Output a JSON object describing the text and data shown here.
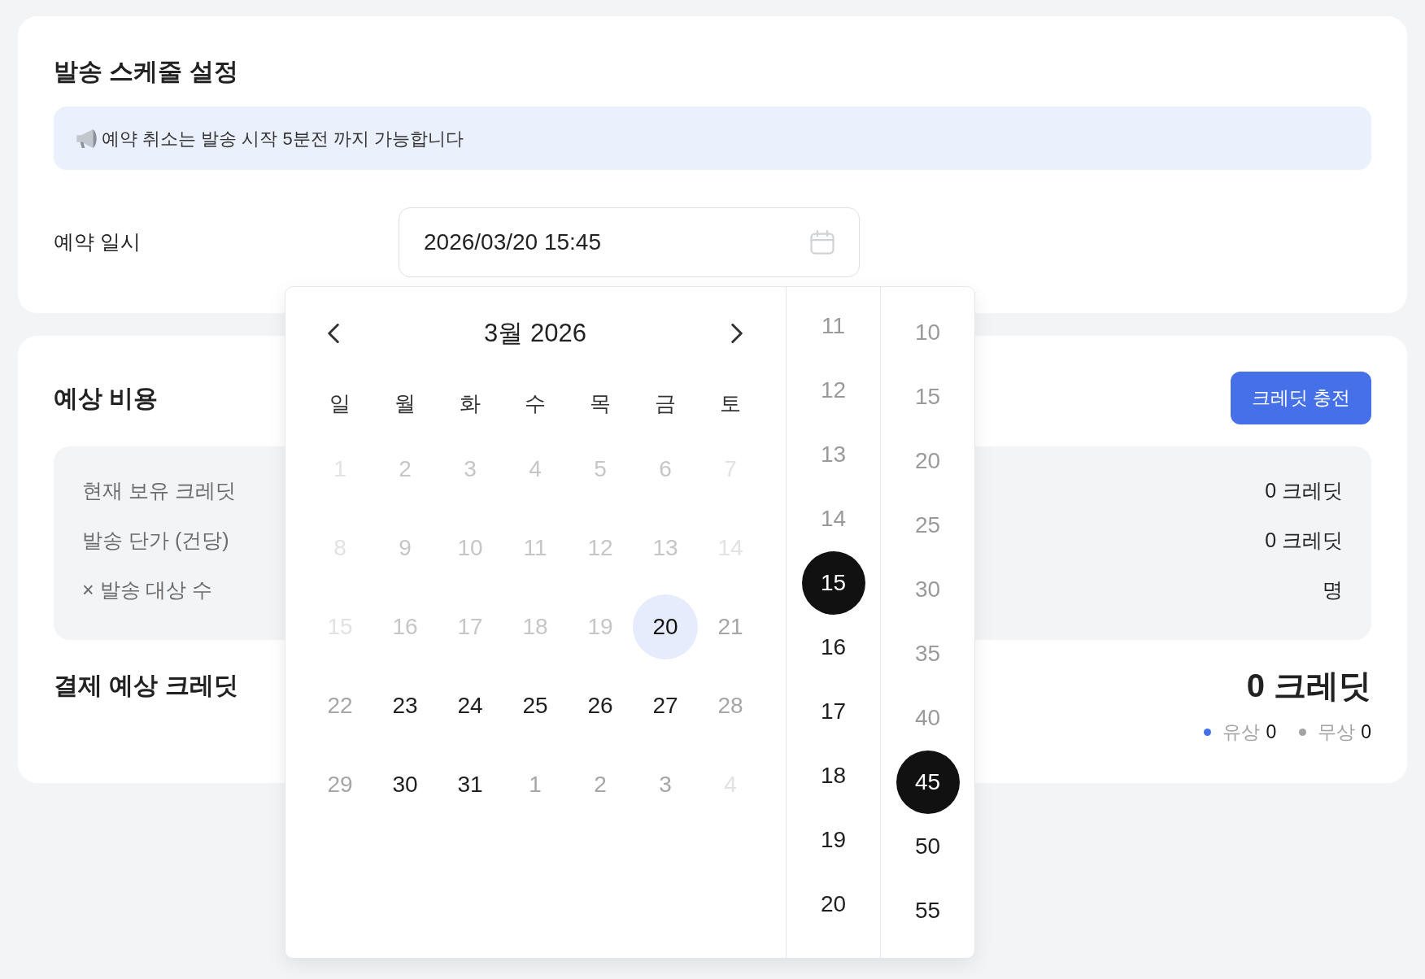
{
  "schedule": {
    "title": "발송 스케줄 설정",
    "notice": "예약 취소는 발송 시작 5분전 까지 가능합니다",
    "field_label": "예약 일시",
    "datetime_field": {
      "value": "2026/03/20 15:45"
    }
  },
  "date_picker": {
    "month_title": "3월 2026",
    "weekdays": [
      "일",
      "월",
      "화",
      "수",
      "목",
      "금",
      "토"
    ],
    "weeks": [
      [
        {
          "label": "1",
          "selected": false,
          "disabled": true,
          "muted": true
        },
        {
          "label": "2",
          "selected": false,
          "disabled": true,
          "muted": false
        },
        {
          "label": "3",
          "selected": false,
          "disabled": true,
          "muted": false
        },
        {
          "label": "4",
          "selected": false,
          "disabled": true,
          "muted": false
        },
        {
          "label": "5",
          "selected": false,
          "disabled": true,
          "muted": false
        },
        {
          "label": "6",
          "selected": false,
          "disabled": true,
          "muted": false
        },
        {
          "label": "7",
          "selected": false,
          "disabled": true,
          "muted": true
        }
      ],
      [
        {
          "label": "8",
          "selected": false,
          "disabled": true,
          "muted": true
        },
        {
          "label": "9",
          "selected": false,
          "disabled": true,
          "muted": false
        },
        {
          "label": "10",
          "selected": false,
          "disabled": true,
          "muted": false
        },
        {
          "label": "11",
          "selected": false,
          "disabled": true,
          "muted": false
        },
        {
          "label": "12",
          "selected": false,
          "disabled": true,
          "muted": false
        },
        {
          "label": "13",
          "selected": false,
          "disabled": true,
          "muted": false
        },
        {
          "label": "14",
          "selected": false,
          "disabled": true,
          "muted": true
        }
      ],
      [
        {
          "label": "15",
          "selected": false,
          "disabled": true,
          "muted": true
        },
        {
          "label": "16",
          "selected": false,
          "disabled": true,
          "muted": false
        },
        {
          "label": "17",
          "selected": false,
          "disabled": true,
          "muted": false
        },
        {
          "label": "18",
          "selected": false,
          "disabled": true,
          "muted": false
        },
        {
          "label": "19",
          "selected": false,
          "disabled": true,
          "muted": false
        },
        {
          "label": "20",
          "selected": true,
          "disabled": false,
          "muted": false
        },
        {
          "label": "21",
          "selected": false,
          "disabled": false,
          "muted": true
        }
      ],
      [
        {
          "label": "22",
          "selected": false,
          "disabled": false,
          "muted": true
        },
        {
          "label": "23",
          "selected": false,
          "disabled": false,
          "muted": false
        },
        {
          "label": "24",
          "selected": false,
          "disabled": false,
          "muted": false
        },
        {
          "label": "25",
          "selected": false,
          "disabled": false,
          "muted": false
        },
        {
          "label": "26",
          "selected": false,
          "disabled": false,
          "muted": false
        },
        {
          "label": "27",
          "selected": false,
          "disabled": false,
          "muted": false
        },
        {
          "label": "28",
          "selected": false,
          "disabled": false,
          "muted": true
        }
      ],
      [
        {
          "label": "29",
          "selected": false,
          "disabled": false,
          "muted": true
        },
        {
          "label": "30",
          "selected": false,
          "disabled": false,
          "muted": false
        },
        {
          "label": "31",
          "selected": false,
          "disabled": false,
          "muted": false
        },
        {
          "label": "1",
          "selected": false,
          "disabled": false,
          "muted": true
        },
        {
          "label": "2",
          "selected": false,
          "disabled": false,
          "muted": true
        },
        {
          "label": "3",
          "selected": false,
          "disabled": false,
          "muted": true
        },
        {
          "label": "4",
          "selected": false,
          "disabled": true,
          "muted": true
        }
      ]
    ],
    "hours": [
      {
        "label": "11",
        "selected": false,
        "disabled": true
      },
      {
        "label": "12",
        "selected": false,
        "disabled": true
      },
      {
        "label": "13",
        "selected": false,
        "disabled": true
      },
      {
        "label": "14",
        "selected": false,
        "disabled": true
      },
      {
        "label": "15",
        "selected": true,
        "disabled": false
      },
      {
        "label": "16",
        "selected": false,
        "disabled": false
      },
      {
        "label": "17",
        "selected": false,
        "disabled": false
      },
      {
        "label": "18",
        "selected": false,
        "disabled": false
      },
      {
        "label": "19",
        "selected": false,
        "disabled": false
      },
      {
        "label": "20",
        "selected": false,
        "disabled": false
      }
    ],
    "minutes": [
      {
        "label": "10",
        "selected": false,
        "disabled": true
      },
      {
        "label": "15",
        "selected": false,
        "disabled": true
      },
      {
        "label": "20",
        "selected": false,
        "disabled": true
      },
      {
        "label": "25",
        "selected": false,
        "disabled": true
      },
      {
        "label": "30",
        "selected": false,
        "disabled": true
      },
      {
        "label": "35",
        "selected": false,
        "disabled": true
      },
      {
        "label": "40",
        "selected": false,
        "disabled": true
      },
      {
        "label": "45",
        "selected": true,
        "disabled": false
      },
      {
        "label": "50",
        "selected": false,
        "disabled": false
      },
      {
        "label": "55",
        "selected": false,
        "disabled": false
      }
    ]
  },
  "cost": {
    "title": "예상 비용",
    "charge_button": "크레딧 충전",
    "rows": [
      {
        "label": "현재 보유 크레딧",
        "value": "0 크레딧"
      },
      {
        "label": "발송 단가 (건당)",
        "value": "0 크레딧"
      },
      {
        "label": "× 발송 대상 수",
        "value": "명"
      }
    ],
    "total": {
      "label": "결제 예상 크레딧",
      "value": "0 크레딧"
    },
    "breakdown": [
      {
        "label": "유상",
        "value": "0",
        "color": "#4670e8"
      },
      {
        "label": "무상",
        "value": "0",
        "color": "#a3a3a3"
      }
    ]
  }
}
